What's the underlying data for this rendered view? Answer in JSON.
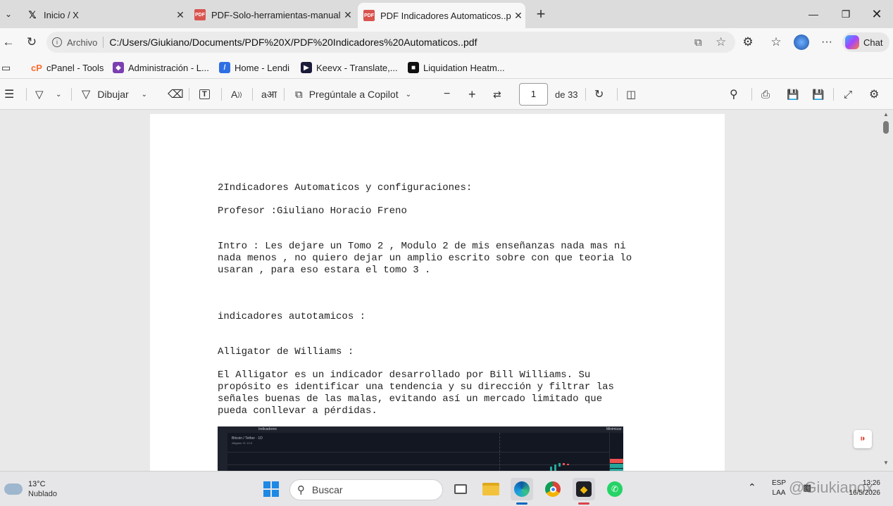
{
  "tabs": [
    {
      "title": "Inicio / X",
      "icon": "x-logo-icon"
    },
    {
      "title": "PDF-Solo-herramientas-manuales.",
      "icon": "pdf-icon"
    },
    {
      "title": "PDF Indicadores Automaticos..pdf",
      "icon": "pdf-icon"
    }
  ],
  "address": {
    "label": "Archivo",
    "url": "C:/Users/Giukiano/Documents/PDF%20X/PDF%20Indicadores%20Automaticos..pdf"
  },
  "chat_label": "Chat",
  "bookmarks": [
    {
      "label": "cPanel - Tools",
      "color": "#ff6c2c"
    },
    {
      "label": "Administración - L...",
      "color": "#7a3fb0"
    },
    {
      "label": "Home - Lendi",
      "color": "#2f6fe4"
    },
    {
      "label": "Keevx - Translate,...",
      "color": "#1b1b3a"
    },
    {
      "label": "Liquidation Heatm...",
      "color": "#111111"
    }
  ],
  "pdf_toolbar": {
    "draw_label": "Dibujar",
    "copilot_label": "Pregúntale a Copilot",
    "page_current": "1",
    "page_total": "de 33"
  },
  "document": {
    "title": "2Indicadores Automaticos y configuraciones:",
    "professor": "Profesor :Giuliano Horacio Freno",
    "intro": "Intro : Les dejare un Tomo 2 , Modulo 2 de mis enseñanzas nada mas ni\nnada menos , no quiero dejar un amplio escrito sobre con que teoria lo\nusaran , para eso estara el tomo 3 .",
    "section": "indicadores autotamicos :",
    "subsection": "Alligator de Williams :",
    "paragraph": "El Alligator es un indicador desarrollado por Bill Williams. Su\npropósito es identificar una tendencia y su dirección y filtrar las\nseñales buenas de las malas, evitando así un mercado limitado que\npueda conllevar a pérdidas.",
    "chart_toolbar_label": "Indicadores",
    "chart_symbol": "Bitcoin / Tether · 1D",
    "chart_sub": "Alligator 21 13 8",
    "chart_right_label": "Minimizar"
  },
  "taskbar": {
    "weather_temp": "13°C",
    "weather_desc": "Nublado",
    "search_placeholder": "Buscar",
    "tray_lang_1": "ESP",
    "tray_lang_2": "LAA",
    "time": "13:26",
    "date": "16/5/2026",
    "watermark": "@Giukianox"
  }
}
